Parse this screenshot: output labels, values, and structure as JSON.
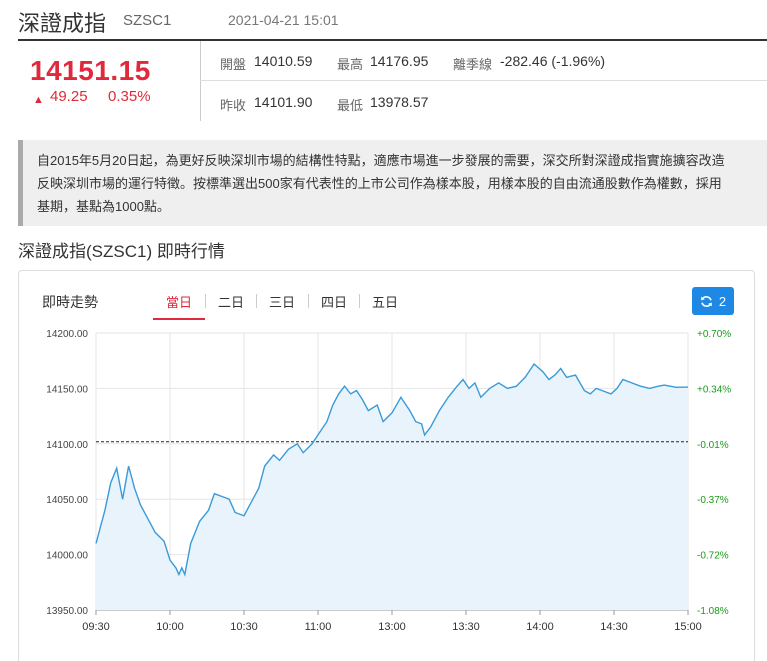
{
  "header": {
    "title": "深證成指",
    "code": "SZSC1",
    "timestamp": "2021-04-21 15:01"
  },
  "quote": {
    "price": "14151.15",
    "change": "49.25",
    "change_pct": "0.35%",
    "direction_icon": "triangle-up-icon",
    "open_label": "開盤",
    "open": "14010.59",
    "high_label": "最高",
    "high": "14176.95",
    "deviation_label": "離季線",
    "deviation": "-282.46 (-1.96%)",
    "prev_close_label": "昨收",
    "prev_close": "14101.90",
    "low_label": "最低",
    "low": "13978.57"
  },
  "intro": {
    "line1": "自2015年5月20日起，為更好反映深圳市場的結構性特點，適應市場進一步發展的需要，深交所對深證成指實施擴容改造",
    "line2": "反映深圳市場的運行特徵。按標準選出500家有代表性的上市公司作為樣本股，用樣本股的自由流通股數作為權數，採用",
    "line3": "基期，基點為1000點。"
  },
  "section_title": "深證成指(SZSC1) 即時行情",
  "panel": {
    "title": "即時走勢",
    "tabs": [
      "當日",
      "二日",
      "三日",
      "四日",
      "五日"
    ],
    "active_tab": 0,
    "refresh_icon": "refresh-icon",
    "refresh_label": "2"
  },
  "colors": {
    "up": "#e0293b",
    "down": "#1a9b1a",
    "line": "#3a9ad9",
    "fill": "#e8f3fc",
    "button": "#1e88e5"
  },
  "chart_data": {
    "type": "area",
    "title": "",
    "xlabel": "",
    "ylabel": "",
    "ylim": [
      13950,
      14200
    ],
    "y_ticks": [
      "14200.00",
      "14150.00",
      "14100.00",
      "14050.00",
      "14000.00",
      "13950.00"
    ],
    "y2_ticks": [
      "+0.70%",
      "+0.34%",
      "-0.01%",
      "-0.37%",
      "-0.72%",
      "-1.08%"
    ],
    "x_ticks": [
      "09:30",
      "10:00",
      "10:30",
      "11:00",
      "13:00",
      "13:30",
      "14:00",
      "14:30",
      "15:00"
    ],
    "reference_value": 14101.9,
    "grid": true,
    "series": [
      {
        "values": [
          [
            0,
            14010
          ],
          [
            3,
            14040
          ],
          [
            5,
            14065
          ],
          [
            7,
            14078
          ],
          [
            9,
            14050
          ],
          [
            11,
            14080
          ],
          [
            13,
            14060
          ],
          [
            15,
            14045
          ],
          [
            17,
            14035
          ],
          [
            20,
            14020
          ],
          [
            23,
            14012
          ],
          [
            25,
            13995
          ],
          [
            27,
            13988
          ],
          [
            28,
            13982
          ],
          [
            29,
            13988
          ],
          [
            30,
            13982
          ],
          [
            32,
            14010
          ],
          [
            35,
            14030
          ],
          [
            38,
            14040
          ],
          [
            40,
            14055
          ],
          [
            43,
            14052
          ],
          [
            45,
            14050
          ],
          [
            47,
            14038
          ],
          [
            50,
            14035
          ],
          [
            52,
            14045
          ],
          [
            55,
            14060
          ],
          [
            57,
            14080
          ],
          [
            60,
            14090
          ],
          [
            62,
            14085
          ],
          [
            65,
            14095
          ],
          [
            68,
            14100
          ],
          [
            70,
            14092
          ],
          [
            73,
            14100
          ],
          [
            75,
            14108
          ],
          [
            78,
            14120
          ],
          [
            80,
            14135
          ],
          [
            82,
            14145
          ],
          [
            84,
            14152
          ],
          [
            86,
            14145
          ],
          [
            88,
            14148
          ],
          [
            90,
            14140
          ],
          [
            92,
            14130
          ],
          [
            95,
            14135
          ],
          [
            97,
            14120
          ],
          [
            100,
            14128
          ],
          [
            103,
            14142
          ],
          [
            106,
            14130
          ],
          [
            108,
            14120
          ],
          [
            110,
            14118
          ],
          [
            111,
            14108
          ],
          [
            113,
            14115
          ],
          [
            116,
            14130
          ],
          [
            119,
            14142
          ],
          [
            122,
            14152
          ],
          [
            124,
            14158
          ],
          [
            126,
            14150
          ],
          [
            128,
            14155
          ],
          [
            130,
            14142
          ],
          [
            133,
            14150
          ],
          [
            136,
            14155
          ],
          [
            139,
            14150
          ],
          [
            142,
            14152
          ],
          [
            145,
            14160
          ],
          [
            148,
            14172
          ],
          [
            151,
            14165
          ],
          [
            153,
            14158
          ],
          [
            155,
            14162
          ],
          [
            157,
            14168
          ],
          [
            159,
            14160
          ],
          [
            162,
            14162
          ],
          [
            165,
            14148
          ],
          [
            167,
            14145
          ],
          [
            169,
            14150
          ],
          [
            171,
            14148
          ],
          [
            174,
            14145
          ],
          [
            176,
            14150
          ],
          [
            178,
            14158
          ],
          [
            181,
            14155
          ],
          [
            184,
            14152
          ],
          [
            187,
            14150
          ],
          [
            190,
            14152
          ],
          [
            192,
            14153
          ],
          [
            194,
            14152
          ],
          [
            196,
            14151
          ],
          [
            200,
            14151.15
          ]
        ]
      }
    ]
  }
}
